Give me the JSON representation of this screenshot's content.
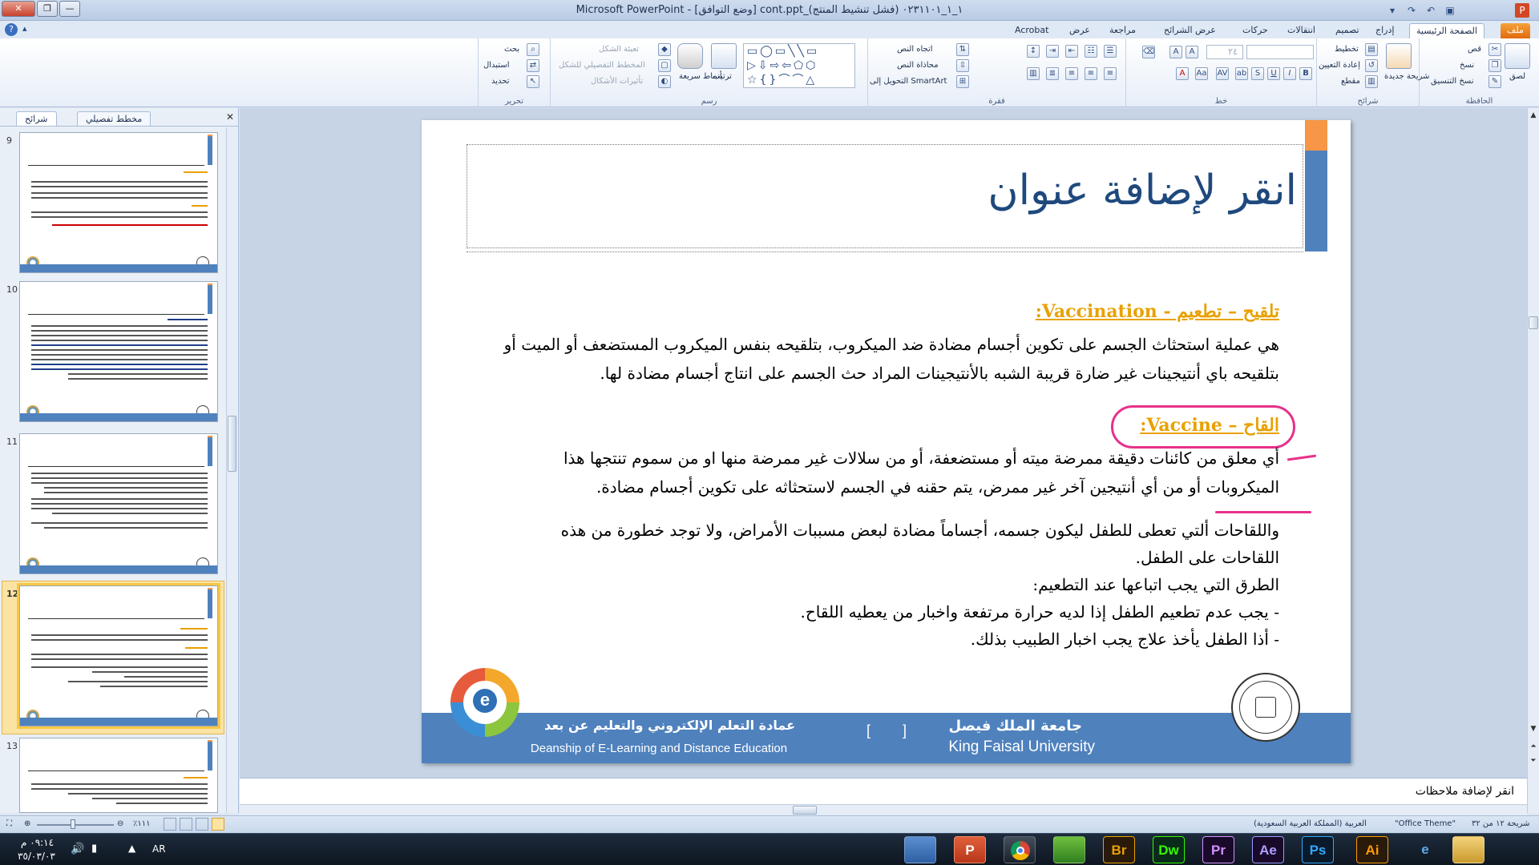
{
  "window": {
    "title": "Microsoft PowerPoint - [وضع التوافق] cont.ppt_١_١_٠٢٣١١٠١ (فشل تنشيط المنتج)",
    "controls": {
      "close": "✕",
      "restore": "❐",
      "minimize": "—"
    }
  },
  "ribbon_tabs": [
    {
      "label": "ملف"
    },
    {
      "label": "الصفحة الرئيسية"
    },
    {
      "label": "إدراج"
    },
    {
      "label": "تصميم"
    },
    {
      "label": "انتقالات"
    },
    {
      "label": "حركات"
    },
    {
      "label": "عرض الشرائح"
    },
    {
      "label": "مراجعة"
    },
    {
      "label": "عرض"
    },
    {
      "label": "Acrobat"
    }
  ],
  "ribbon": {
    "clipboard": {
      "group": "الحافظة",
      "paste": "لصق",
      "cut": "قص",
      "copy": "نسخ",
      "format_painter": "نسخ التنسيق"
    },
    "slides": {
      "group": "شرائح",
      "new_slide": "شريحة جديدة",
      "layout": "تخطيط",
      "reset": "إعادة التعيين",
      "section": "مقطع"
    },
    "font": {
      "group": "خط",
      "size": "٢٤"
    },
    "paragraph": {
      "group": "فقرة",
      "text_direction": "اتجاه النص",
      "align_text": "محاذاة النص",
      "smartart": "التحويل إلى SmartArt"
    },
    "drawing": {
      "group": "رسم",
      "arrange": "ترتيب",
      "quick_styles": "أنماط سريعة",
      "shape_fill": "تعبئة الشكل",
      "shape_outline": "المخطط التفصيلي للشكل",
      "shape_effects": "تأثيرات الأشكال"
    },
    "editing": {
      "group": "تحرير",
      "find": "بحث",
      "replace": "استبدال",
      "select": "تحديد"
    }
  },
  "left_pane": {
    "tabs": {
      "slides": "شرائح",
      "outline": "مخطط تفصيلي"
    },
    "thumbnails": [
      {
        "number": "9"
      },
      {
        "number": "10"
      },
      {
        "number": "11"
      },
      {
        "number": "12"
      },
      {
        "number": "13"
      }
    ],
    "selected": "12"
  },
  "slide": {
    "title_placeholder": "انقر لإضافة عنوان",
    "heading1": "تلقيح – تطعيم - Vaccination:",
    "para1_line1": "هي عملية استحثاث الجسم على تكوين أجسام مضادة ضد الميكروب، بتلقيحه بنفس الميكروب المستضعف أو الميت أو",
    "para1_line2": "بتلقيحه باي أنتيجينات غير ضارة قريبة الشبه بالأنتيجينات المراد حث الجسم على انتاج أجسام مضادة لها.",
    "heading2": "القاح – Vaccine:",
    "para2_line1": "أي معلق من كائنات دقيقة ممرضة ميته أو مستضعفة، أو من سلالات غير ممرضة منها او من سموم تنتجها هذا",
    "para2_line2": "الميكروبات أو من أي أنتيجين آخر غير ممرض، يتم حقنه في الجسم لاستحثاثه على تكوين أجسام مضادة.",
    "para3_line1": "واللقاحات ألتي تعطى للطفل ليكون جسمه، أجساماً مضادة لبعض مسببات الأمراض، ولا توجد خطورة من هذه",
    "para3_line2": "اللقاحات على الطفل.",
    "para4": "الطرق التي يجب اتباعها عند التطعيم:",
    "bullet1": "- يجب عدم تطعيم الطفل إذا لديه حرارة مرتفعة واخبار من يعطيه اللقاح.",
    "bullet2": "- أذا الطفل يأخذ علاج يجب اخبار الطبيب بذلك.",
    "footer": {
      "deanship_ar": "عمادة التعلم الإلكتروني والتعليم عن بعد",
      "deanship_en": "Deanship of E-Learning and Distance Education",
      "bracket": "[        ]",
      "university_ar": "جامعة الملك فيصل",
      "university_en": "King Faisal University"
    },
    "colors": {
      "accent_blue": "#4f81bd",
      "accent_orange": "#f79646",
      "heading_orange": "#e8a100",
      "annotation_pink": "#e8308a"
    }
  },
  "notes_placeholder": "انقر لإضافة ملاحظات",
  "status_bar": {
    "slide_info": "شريحة ١٢ من ٣٢",
    "theme": "\"Office Theme\"",
    "language": "العربية (المملكة العربية السعودية)",
    "zoom": "٪١١١"
  },
  "taskbar": {
    "apps": [
      "Br",
      "Dw",
      "Pr",
      "Ae",
      "Ps",
      "Ai"
    ],
    "lang": "AR",
    "time": "٠٩:١٤ م",
    "date": "٣٥/٠٣/٠٣"
  }
}
